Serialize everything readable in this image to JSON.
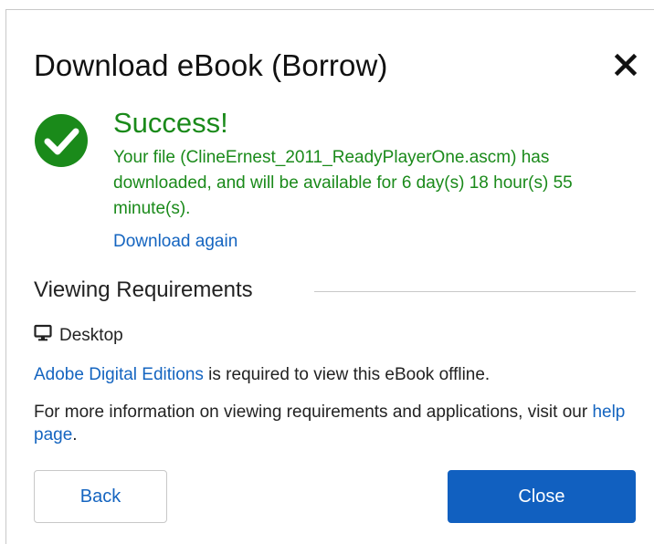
{
  "dialog": {
    "title": "Download eBook (Borrow)",
    "close_icon": "close-icon"
  },
  "success": {
    "icon": "check-circle-icon",
    "title": "Success!",
    "message": "Your file (ClineErnest_2011_ReadyPlayerOne.ascm) has downloaded, and will be available for 6 day(s) 18 hour(s) 55 minute(s).",
    "download_again": "Download again"
  },
  "requirements": {
    "heading": "Viewing Requirements",
    "platform_icon": "desktop-icon",
    "platform": "Desktop",
    "app_link": "Adobe Digital Editions",
    "app_suffix": " is required to view this eBook offline.",
    "info_prefix": "For more information on viewing requirements and applications, visit our ",
    "help_link": "help page",
    "info_suffix": "."
  },
  "buttons": {
    "back": "Back",
    "close": "Close"
  },
  "colors": {
    "success": "#1a8a1a",
    "link": "#1565c0",
    "primary": "#1160c0"
  }
}
